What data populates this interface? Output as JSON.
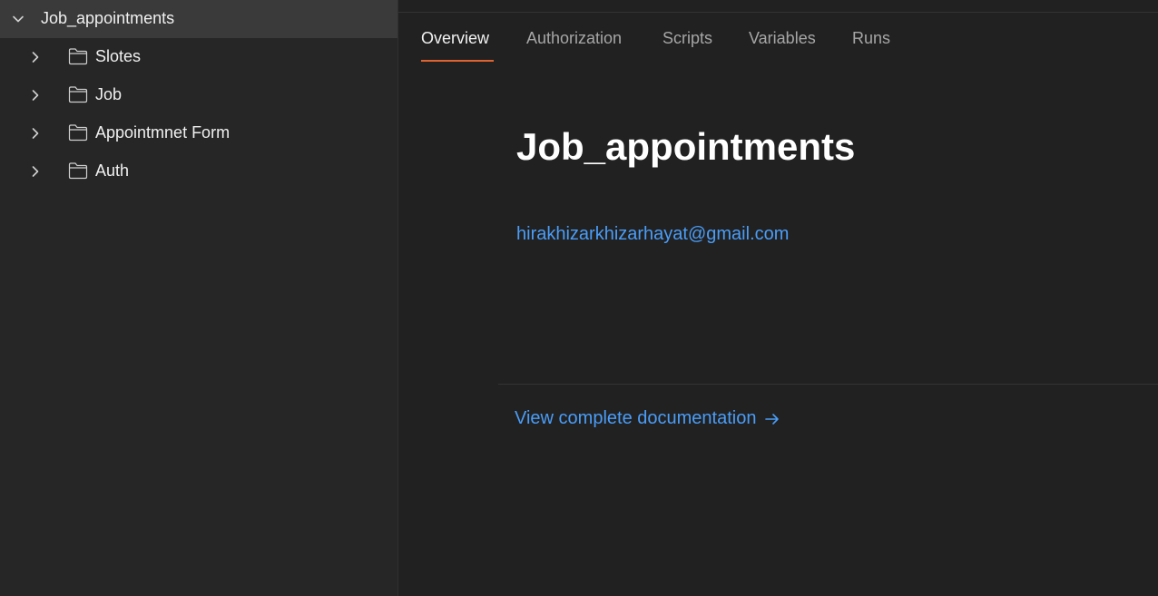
{
  "sidebar": {
    "collection": {
      "label": "Job_appointments",
      "expanded_icon": "chevron-down-icon"
    },
    "folders": [
      {
        "label": "Slotes",
        "icon": "folder-icon"
      },
      {
        "label": "Job",
        "icon": "folder-icon"
      },
      {
        "label": "Appointmnet Form",
        "icon": "folder-icon"
      },
      {
        "label": "Auth",
        "icon": "folder-icon"
      }
    ]
  },
  "main": {
    "tabs": [
      {
        "label": "Overview",
        "active": true
      },
      {
        "label": "Authorization",
        "active": false
      },
      {
        "label": "Scripts",
        "active": false
      },
      {
        "label": "Variables",
        "active": false
      },
      {
        "label": "Runs",
        "active": false
      }
    ],
    "title": "Job_appointments",
    "email": "hirakhizarkhizarhayat@gmail.com",
    "doc_link": "View complete documentation"
  },
  "colors": {
    "accent": "#e0632f",
    "link": "#4a9df8",
    "sidebar_bg": "#262626",
    "selected_row_bg": "#3a3a3a",
    "main_bg": "#212121"
  }
}
